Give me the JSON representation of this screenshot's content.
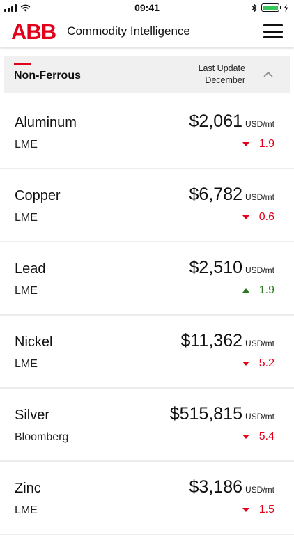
{
  "status_bar": {
    "time": "09:41"
  },
  "header": {
    "logo": "ABB",
    "title": "Commodity Intelligence"
  },
  "section": {
    "title": "Non-Ferrous",
    "last_update_label": "Last Update",
    "last_update_value": "December"
  },
  "colors": {
    "brand": "#e2001a",
    "down": "#e2001a",
    "up": "#2a7a1f",
    "section_bg": "#f0f0f0"
  },
  "commodities": [
    {
      "name": "Aluminum",
      "source": "LME",
      "price": "$2,061",
      "unit": "USD/mt",
      "change": "1.9",
      "direction": "down"
    },
    {
      "name": "Copper",
      "source": "LME",
      "price": "$6,782",
      "unit": "USD/mt",
      "change": "0.6",
      "direction": "down"
    },
    {
      "name": "Lead",
      "source": "LME",
      "price": "$2,510",
      "unit": "USD/mt",
      "change": "1.9",
      "direction": "up"
    },
    {
      "name": "Nickel",
      "source": "LME",
      "price": "$11,362",
      "unit": "USD/mt",
      "change": "5.2",
      "direction": "down"
    },
    {
      "name": "Silver",
      "source": "Bloomberg",
      "price": "$515,815",
      "unit": "USD/mt",
      "change": "5.4",
      "direction": "down"
    },
    {
      "name": "Zinc",
      "source": "LME",
      "price": "$3,186",
      "unit": "USD/mt",
      "change": "1.5",
      "direction": "down"
    }
  ]
}
